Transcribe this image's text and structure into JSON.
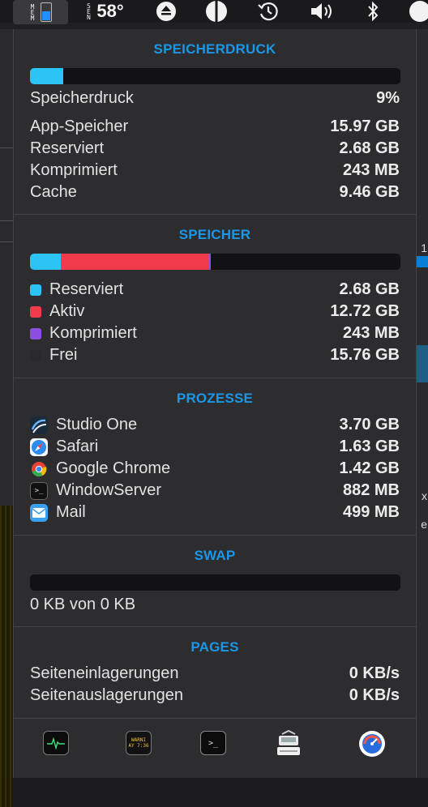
{
  "menubar": {
    "mem_label": "MEM",
    "sensor_label": "SEN",
    "temperature": "58°",
    "icons": [
      "eject-icon",
      "contrast-icon",
      "time-machine-icon",
      "volume-icon",
      "bluetooth-icon"
    ]
  },
  "memory_pressure": {
    "title": "SPEICHERDRUCK",
    "bar_fraction": 0.09,
    "bar_color": "#2bc4f5",
    "rows": [
      {
        "label": "Speicherdruck",
        "value": "9%"
      },
      {
        "label": "App-Speicher",
        "value": "15.97 GB"
      },
      {
        "label": "Reserviert",
        "value": "2.68 GB"
      },
      {
        "label": "Komprimiert",
        "value": "243 MB"
      },
      {
        "label": "Cache",
        "value": "9.46 GB"
      }
    ]
  },
  "memory": {
    "title": "SPEICHER",
    "segments": [
      {
        "name": "reserved",
        "fraction": 0.0838,
        "color": "#2bc4f5"
      },
      {
        "name": "active",
        "fraction": 0.3975,
        "color": "#f23b4a"
      },
      {
        "name": "compressed",
        "fraction": 0.0076,
        "color": "#8a4fe0"
      }
    ],
    "rows": [
      {
        "label": "Reserviert",
        "value": "2.68 GB",
        "color": "#2bc4f5"
      },
      {
        "label": "Aktiv",
        "value": "12.72 GB",
        "color": "#f23b4a"
      },
      {
        "label": "Komprimiert",
        "value": "243 MB",
        "color": "#8a4fe0"
      },
      {
        "label": "Frei",
        "value": "15.76 GB",
        "color": "#2a2a2c"
      }
    ]
  },
  "processes": {
    "title": "PROZESSE",
    "rows": [
      {
        "label": "Studio One",
        "value": "3.70 GB",
        "icon": "studio-one-icon"
      },
      {
        "label": "Safari",
        "value": "1.63 GB",
        "icon": "safari-icon"
      },
      {
        "label": "Google Chrome",
        "value": "1.42 GB",
        "icon": "chrome-icon"
      },
      {
        "label": "WindowServer",
        "value": "882 MB",
        "icon": "terminal-icon"
      },
      {
        "label": "Mail",
        "value": "499 MB",
        "icon": "mail-icon"
      }
    ]
  },
  "swap": {
    "title": "SWAP",
    "bar_fraction": 0,
    "summary": "0 KB von 0 KB"
  },
  "pages": {
    "title": "PAGES",
    "rows": [
      {
        "label": "Seiteneinlagerungen",
        "value": "0 KB/s"
      },
      {
        "label": "Seitenauslagerungen",
        "value": "0 KB/s"
      }
    ]
  },
  "toolbar": {
    "console_badge_line1": "WARNI",
    "console_badge_line2": "AY 7:36",
    "terminal_glyph": ">_",
    "icons": [
      "activity-monitor-icon",
      "console-icon",
      "terminal-icon",
      "system-information-icon",
      "istat-icon"
    ]
  },
  "background_glyphs": {
    "right_1": "1",
    "right_x": "x",
    "right_e": "e"
  }
}
